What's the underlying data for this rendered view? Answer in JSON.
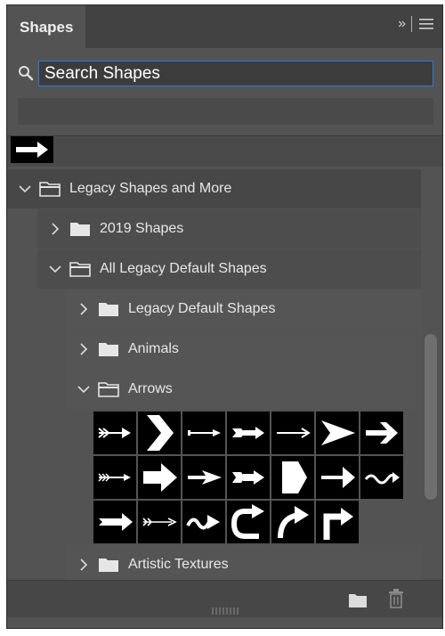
{
  "panel": {
    "tab_title": "Shapes",
    "menu_collapse_glyph": "»",
    "menu_icon": "hamburger-menu-icon"
  },
  "search": {
    "placeholder": "Search Shapes",
    "value": ""
  },
  "tree": {
    "legacy_group": "Legacy Shapes and More",
    "shapes_2019": "2019 Shapes",
    "all_legacy_default": "All Legacy Default Shapes",
    "legacy_default": "Legacy Default Shapes",
    "animals": "Animals",
    "arrows": "Arrows",
    "artistic_textures": "Artistic Textures"
  },
  "arrow_shapes": [
    "feathered-arrow",
    "chevron",
    "thin-arrow",
    "double-feather-arrow",
    "line-arrow",
    "dart-arrow",
    "bold-arrow",
    "fletched-arrow",
    "block-arrow",
    "pointer-arrow",
    "double-head-arrow",
    "pentagon-arrow",
    "solid-arrow",
    "wavy-arrow",
    "notched-arrow",
    "quiver-arrow",
    "squiggle-arrow",
    "u-turn-arrow",
    "curved-arrow",
    "corner-arrow"
  ],
  "bottom": {
    "new_group_icon": "folder-icon",
    "delete_icon": "trash-icon"
  },
  "colors": {
    "panel_bg": "#535353",
    "tab_bg": "#424242",
    "accent_focus": "#2d7be0",
    "thumb_bg": "#000000"
  }
}
